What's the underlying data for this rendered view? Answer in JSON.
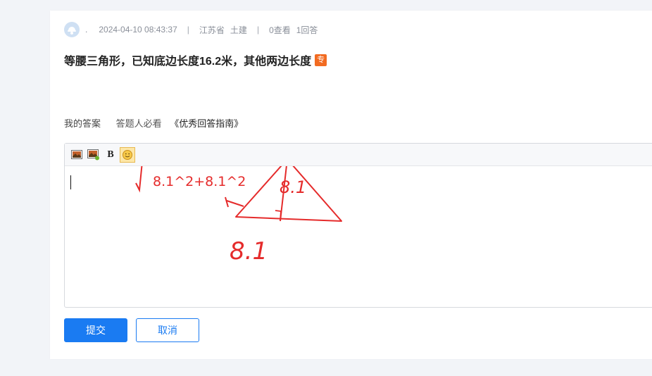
{
  "question": {
    "author": ".",
    "datetime": "2024-04-10 08:43:37",
    "province": "江苏省",
    "category": "土建",
    "views": "0查看",
    "answers": "1回答",
    "title": "等腰三角形，已知底边长度16.2米，其他两边长度",
    "badge": "专"
  },
  "answer_section": {
    "label": "我的答案",
    "guide_prefix": "答题人必看",
    "guide_link": "《优秀回答指南》"
  },
  "editor": {
    "toolbar": {
      "bold_label": "B"
    },
    "handwriting": {
      "formula": "8.1^2+8.1^2",
      "side_label": "8.1",
      "base_label": "8.1"
    }
  },
  "actions": {
    "submit_label": "提交",
    "cancel_label": "取消"
  },
  "colors": {
    "accent": "#1a7bf2",
    "badge": "#f26b21",
    "ink": "#e52b2b"
  }
}
